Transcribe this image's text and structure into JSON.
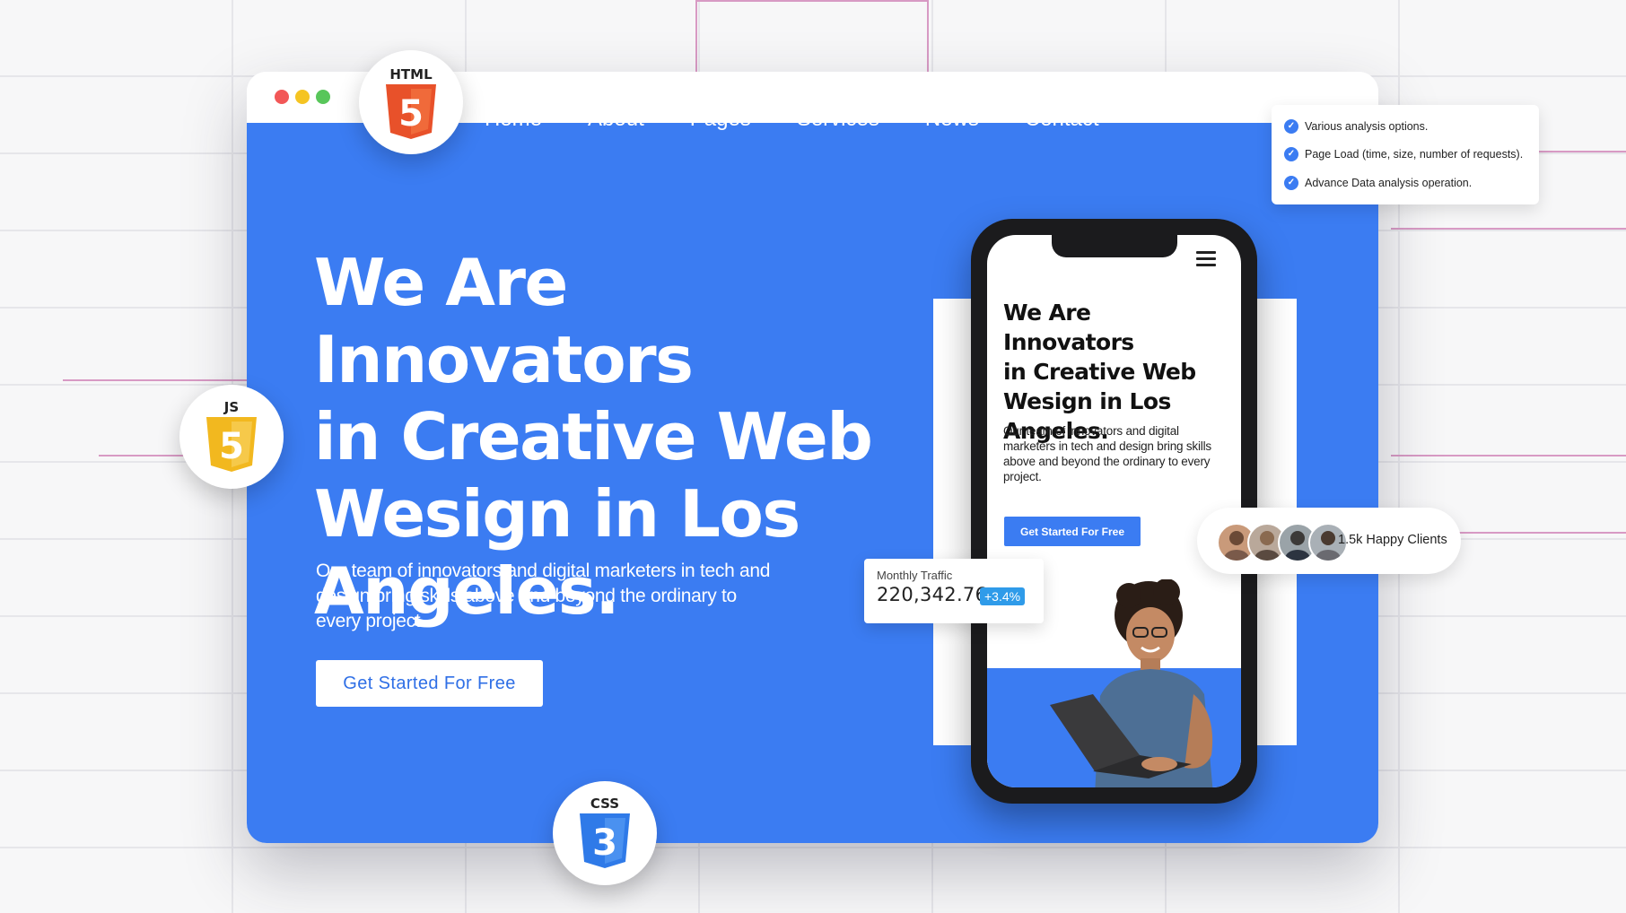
{
  "window": {
    "controls": [
      "close",
      "minimize",
      "maximize"
    ]
  },
  "nav": [
    {
      "label": "Home"
    },
    {
      "label": "About"
    },
    {
      "label": "Pages"
    },
    {
      "label": "Services"
    },
    {
      "label": "News"
    },
    {
      "label": "Contact"
    }
  ],
  "hero": {
    "headline_lines": [
      "We Are Innovators",
      "in Creative Web",
      "Wesign in Los",
      "Angeles."
    ],
    "subtext": "Our team of innovators and digital marketers in tech and design bring skills above and beyond the ordinary to every project.",
    "cta_label": "Get Started For Free"
  },
  "phone": {
    "title_lines": [
      "We Are Innovators",
      "in Creative Web",
      "Wesign in Los",
      "Angeles."
    ],
    "body": "Our team of innovators and digital marketers in tech and design bring skills above and beyond the ordinary to every project.",
    "cta_label": "Get Started For Free"
  },
  "traffic": {
    "label": "Monthly Traffic",
    "value": "220,342.76",
    "change": "+3.4%"
  },
  "checklist": [
    {
      "text": "Various analysis options."
    },
    {
      "text": "Page Load (time, size, number of requests)."
    },
    {
      "text": "Advance Data analysis operation."
    }
  ],
  "clients": {
    "text": "1.5k Happy Clients"
  },
  "badges": {
    "html": {
      "label": "HTML",
      "number": "5"
    },
    "js": {
      "label": "JS",
      "number": "5"
    },
    "css": {
      "label": "CSS",
      "number": "3"
    }
  },
  "colors": {
    "brand_blue": "#3b7cf2",
    "html_orange": "#e8512a",
    "js_yellow": "#f2b81f",
    "css_blue": "#2f7ae8"
  }
}
